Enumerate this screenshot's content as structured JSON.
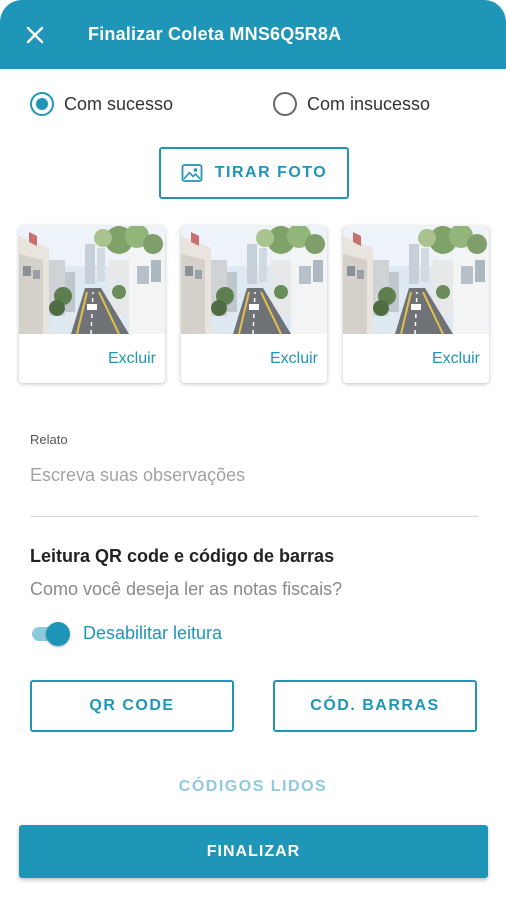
{
  "header": {
    "title": "Finalizar Coleta MNS6Q5R8A",
    "close_icon": "close-icon"
  },
  "status": {
    "options": [
      "Com sucesso",
      "Com insucesso"
    ],
    "selected": "Com sucesso"
  },
  "photo": {
    "button_label": "TIRAR FOTO",
    "icon": "image-icon"
  },
  "photos": [
    {
      "delete_label": "Excluir"
    },
    {
      "delete_label": "Excluir"
    },
    {
      "delete_label": "Excluir"
    }
  ],
  "report": {
    "label": "Relato",
    "placeholder": "Escreva suas observações",
    "value": ""
  },
  "reader": {
    "title": "Leitura QR code e código de barras",
    "subtitle": "Como você deseja ler as notas fiscais?",
    "toggle_label": "Desabilitar leitura",
    "toggle_on": true,
    "qr_label": "QR CODE",
    "barcode_label": "CÓD. BARRAS",
    "codes_read_label": "CÓDIGOS LIDOS"
  },
  "footer": {
    "finalize_label": "FINALIZAR"
  },
  "colors": {
    "primary": "#1f95b8",
    "primary_light": "#8ecadd",
    "placeholder": "#a3a3a3"
  }
}
